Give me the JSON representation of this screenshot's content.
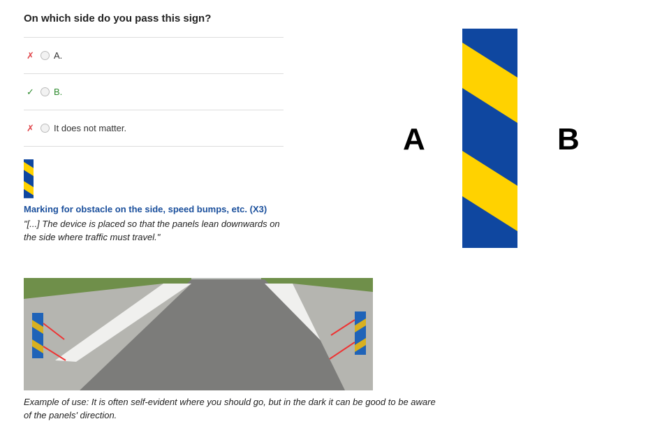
{
  "question": "On which side do you pass this sign?",
  "options": [
    {
      "label": "A.",
      "result": "incorrect",
      "mark": "✗"
    },
    {
      "label": "B.",
      "result": "correct",
      "mark": "✓"
    },
    {
      "label": "It does not matter.",
      "result": "incorrect",
      "mark": "✗"
    }
  ],
  "sign_info": {
    "title": "Marking for obstacle on the side, speed bumps, etc. (X3)",
    "quote": "\"[...] The device is placed so that the panels lean downwards on the side where traffic must travel.\""
  },
  "figure": {
    "label_a": "A",
    "label_b": "B"
  },
  "example_caption": "Example of use: It is often self-evident where you should go, but in the dark it can be good to be aware of the panels' direction.",
  "colors": {
    "blue": "#0f47a0",
    "yellow": "#ffd200",
    "correct": "#2e8b2e",
    "incorrect": "#e0464b"
  }
}
